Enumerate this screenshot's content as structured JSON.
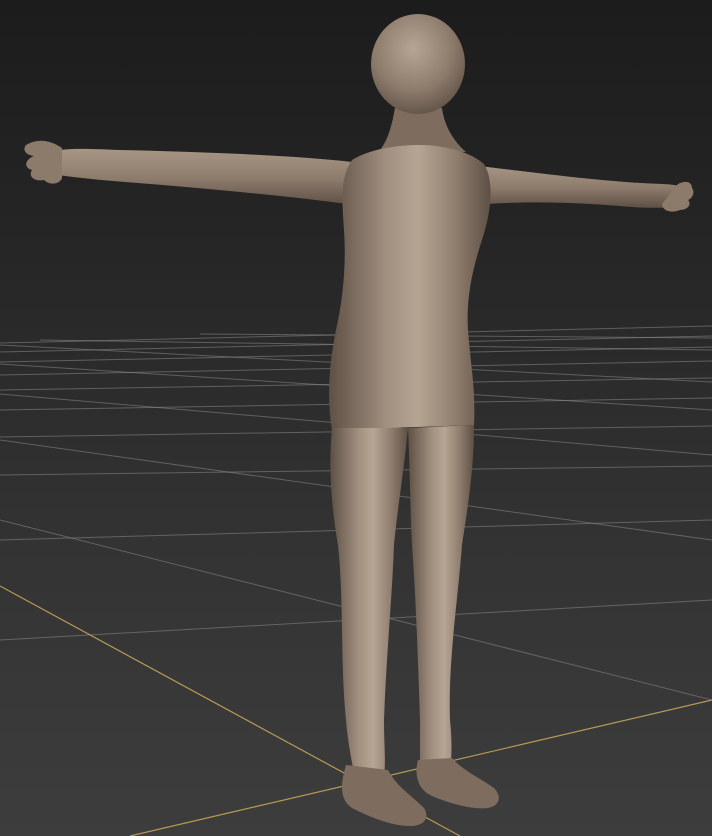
{
  "viewport": {
    "colors": {
      "background_top": "#1c1c1c",
      "background_bottom": "#3d3d3d",
      "grid_line": "#8a8a8a",
      "axis_line": "#b89a55",
      "model_base": "#8c7a6b",
      "model_highlight": "#b7a594",
      "model_shadow": "#5e5045"
    }
  }
}
